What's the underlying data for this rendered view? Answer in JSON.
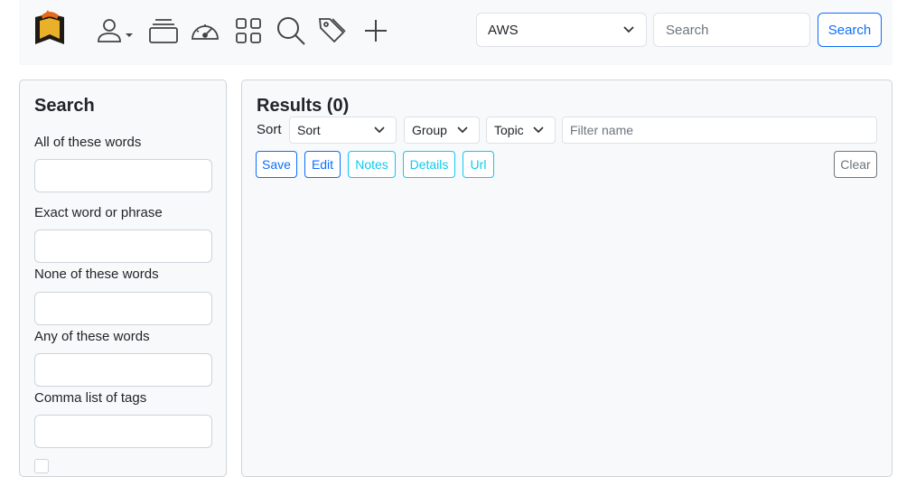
{
  "nav": {
    "logo_icon": "app-logo",
    "icons": [
      "user-icon",
      "chevron-down-icon",
      "collections-icon",
      "dashboard-icon",
      "grid-icon",
      "search-icon",
      "tags-icon",
      "plus-icon"
    ],
    "collection_select": "AWS",
    "search_placeholder": "Search",
    "search_button": "Search"
  },
  "left": {
    "title": "Search",
    "fields": [
      {
        "label": "All of these words"
      },
      {
        "label": "Exact word or phrase"
      },
      {
        "label": "None of these words"
      },
      {
        "label": "Any of these words"
      },
      {
        "label": "Comma list of tags"
      }
    ]
  },
  "results": {
    "title": "Results (0)",
    "sort_label": "Sort",
    "sort_select": "Sort",
    "group_select": "Group",
    "topic_select": "Topic",
    "filter_placeholder": "Filter name",
    "buttons": {
      "save": "Save",
      "edit": "Edit",
      "notes": "Notes",
      "details": "Details",
      "url": "Url",
      "clear": "Clear"
    }
  },
  "colors": {
    "primary": "#0d6efd",
    "info": "#0dcaf0",
    "secondary": "#6c757d",
    "panel_bg": "#f8f9fa"
  }
}
